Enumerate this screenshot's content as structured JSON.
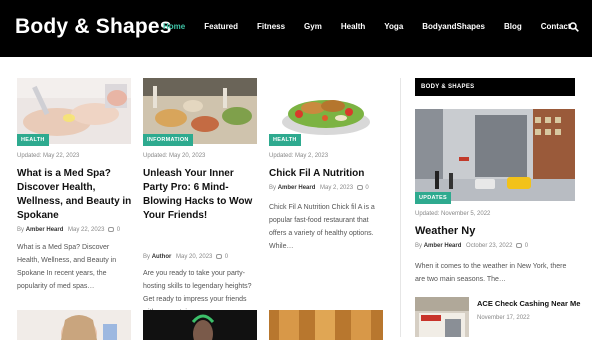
{
  "site": {
    "logo": "Body & Shapes"
  },
  "nav": {
    "items": [
      "Home",
      "Featured",
      "Fitness",
      "Gym",
      "Health",
      "Yoga",
      "BodyandShapes",
      "Blog",
      "Contact"
    ],
    "active": "Home"
  },
  "search": {
    "icon": "search-icon"
  },
  "posts": [
    {
      "badge": "HEALTH",
      "updated": "Updated:  May 22, 2023",
      "title": "What is a Med Spa? Discover Health, Wellness, and Beauty in Spokane",
      "by": "By",
      "author": "Amber Heard",
      "date": "May 22, 2023",
      "comments": "0",
      "excerpt": "What is a Med Spa? Discover Health, Wellness, and Beauty in Spokane In recent years, the popularity of med spas…"
    },
    {
      "badge": "INFORMATION",
      "updated": "Updated:  May 20, 2023",
      "title": "Unleash Your Inner Party Pro: 6 Mind-Blowing Hacks to Wow Your Friends!",
      "by": "By",
      "author": "Author",
      "date": "May 20, 2023",
      "comments": "0",
      "excerpt": "Are you ready to take your party-hosting skills to legendary heights? Get ready to impress your friends with a repertoire…"
    },
    {
      "badge": "HEALTH",
      "updated": "Updated:  May 2, 2023",
      "title": "Chick Fil A Nutrition",
      "by": "By",
      "author": "Amber Heard",
      "date": "May 2, 2023",
      "comments": "0",
      "excerpt": "Chick Fil A Nutrition Chick fil A is a popular fast-food restaurant that offers a variety of healthy options. While…"
    }
  ],
  "sidebar": {
    "heading": "BODY & SHAPES",
    "feature": {
      "badge": "UPDATES",
      "updated": "Updated:  November 5, 2022",
      "title": "Weather Ny",
      "by": "By",
      "author": "Amber Heard",
      "date": "October 23, 2022",
      "comments": "0",
      "excerpt": "When it comes to the weather in New York, there are two main seasons. The…"
    },
    "small": {
      "title": "ACE Check Cashing Near Me",
      "date": "November 17, 2022"
    }
  },
  "colors": {
    "accent": "#2eaa8f",
    "nav_active": "#3ec3a6",
    "header_bg": "#000000"
  }
}
